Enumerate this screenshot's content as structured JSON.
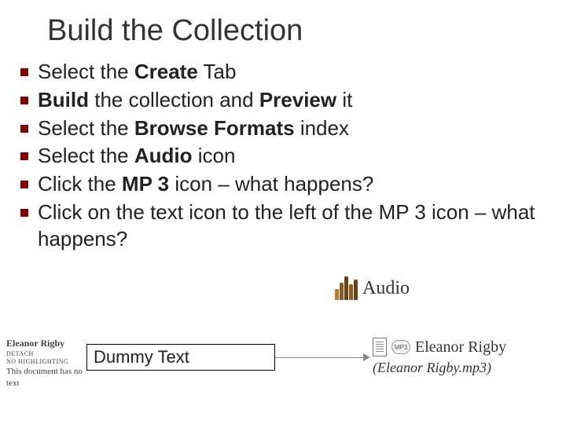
{
  "title": "Build the Collection",
  "bullets": [
    {
      "pre": "Select the ",
      "b1": "Create",
      "post": " Tab"
    },
    {
      "b1": "Build",
      "mid": " the collection and ",
      "b2": "Preview",
      "post": " it"
    },
    {
      "pre": "Select the ",
      "b1": "Browse Formats",
      "post": " index"
    },
    {
      "pre": "Select the ",
      "b1": "Audio",
      "post": " icon"
    },
    {
      "pre": "Click the ",
      "b1": "MP 3",
      "post": " icon – what happens?"
    },
    {
      "pre": "Click on the text icon to the left of the MP 3 icon – what happens?"
    }
  ],
  "audio_label": "Audio",
  "left_snippet": {
    "title": "Eleanor Rigby",
    "l1": "DETACH",
    "l2": "NO HIGHLIGHTING",
    "l3": "This document has no text"
  },
  "dummy_text": "Dummy Text",
  "file": {
    "mp3_badge": "MP3",
    "name": "Eleanor Rigby",
    "sub": "(Eleanor Rigby.mp3)"
  }
}
